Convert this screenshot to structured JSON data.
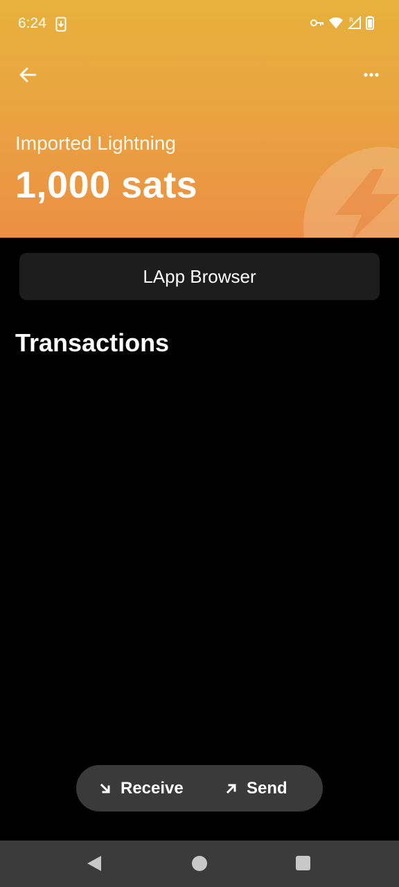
{
  "status_bar": {
    "time": "6:24",
    "icons": [
      "download-icon",
      "vpn-key-icon",
      "wifi-icon",
      "signal-icon",
      "battery-icon"
    ]
  },
  "header": {
    "wallet_name": "Imported Lightning",
    "balance": "1,000 sats",
    "colors": {
      "gradient_top": "#e8b13c",
      "gradient_bottom": "#ec8f44"
    }
  },
  "lapp_browser": {
    "label": "LApp Browser"
  },
  "transactions": {
    "title": "Transactions",
    "items": []
  },
  "actions": {
    "receive_label": "Receive",
    "send_label": "Send"
  },
  "nav_bar": {
    "icons": [
      "back-triangle-icon",
      "home-circle-icon",
      "recents-square-icon"
    ]
  }
}
